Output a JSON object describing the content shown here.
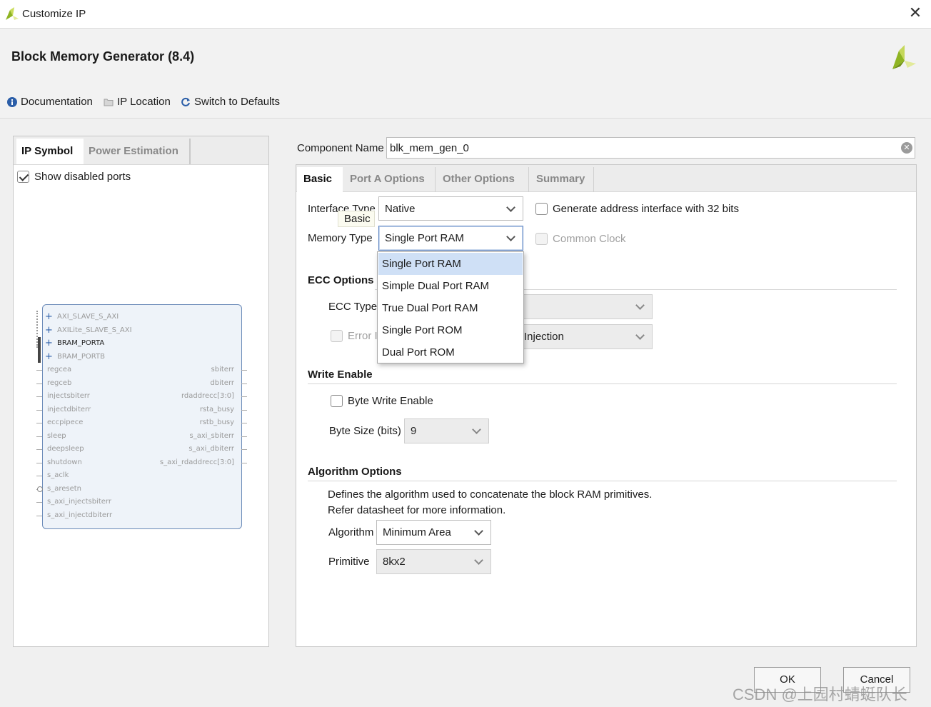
{
  "window": {
    "title": "Customize IP"
  },
  "header": {
    "ip_title": "Block Memory Generator (8.4)",
    "buttons": {
      "documentation": "Documentation",
      "ip_location": "IP Location",
      "switch_defaults": "Switch to Defaults"
    }
  },
  "left_panel": {
    "tabs": [
      "IP Symbol",
      "Power Estimation"
    ],
    "show_disabled_ports": {
      "label": "Show disabled ports",
      "checked": true
    },
    "symbol": {
      "bus_ports": [
        "AXI_SLAVE_S_AXI",
        "AXILite_SLAVE_S_AXI",
        "BRAM_PORTA",
        "BRAM_PORTB"
      ],
      "left_ports": [
        "regcea",
        "regceb",
        "injectsbiterr",
        "injectdbiterr",
        "eccpipece",
        "sleep",
        "deepsleep",
        "shutdown",
        "s_aclk",
        "s_aresetn",
        "s_axi_injectsbiterr",
        "s_axi_injectdbiterr"
      ],
      "right_ports": [
        "sbiterr",
        "dbiterr",
        "rdaddrecc[3:0]",
        "rsta_busy",
        "rstb_busy",
        "s_axi_sbiterr",
        "s_axi_dbiterr",
        "s_axi_rdaddrecc[3:0]"
      ]
    }
  },
  "component": {
    "label": "Component Name",
    "value": "blk_mem_gen_0"
  },
  "right_panel": {
    "tabs": [
      "Basic",
      "Port A Options",
      "Other Options",
      "Summary"
    ],
    "interface_type": {
      "label": "Interface Type",
      "value": "Native"
    },
    "tooltip": "Basic",
    "memory_type": {
      "label": "Memory Type",
      "value": "Single Port RAM",
      "options": [
        "Single Port RAM",
        "Simple Dual Port RAM",
        "True Dual Port RAM",
        "Single Port ROM",
        "Dual Port ROM"
      ]
    },
    "gen_addr_32": {
      "label": "Generate address interface with 32 bits",
      "checked": false
    },
    "common_clock": {
      "label": "Common Clock",
      "checked": false
    },
    "ecc": {
      "section": "ECC Options",
      "type_label": "ECC Type",
      "error_label": "Error I",
      "injection_value": "Injection"
    },
    "write_enable": {
      "section": "Write Enable",
      "byte_write": "Byte Write Enable",
      "byte_size_label": "Byte Size (bits)",
      "byte_size_value": "9"
    },
    "algorithm": {
      "section": "Algorithm Options",
      "desc1": "Defines the algorithm used to concatenate the block RAM primitives.",
      "desc2": "Refer datasheet for more information.",
      "algorithm_label": "Algorithm",
      "algorithm_value": "Minimum Area",
      "primitive_label": "Primitive",
      "primitive_value": "8kx2"
    }
  },
  "footer": {
    "ok": "OK",
    "cancel": "Cancel"
  },
  "watermark": "CSDN @上园村蜻蜓队长",
  "colors": {
    "accent_blue": "#5f86c2",
    "selection": "#cfe0f6",
    "logo_green": "#9bbf2a"
  }
}
